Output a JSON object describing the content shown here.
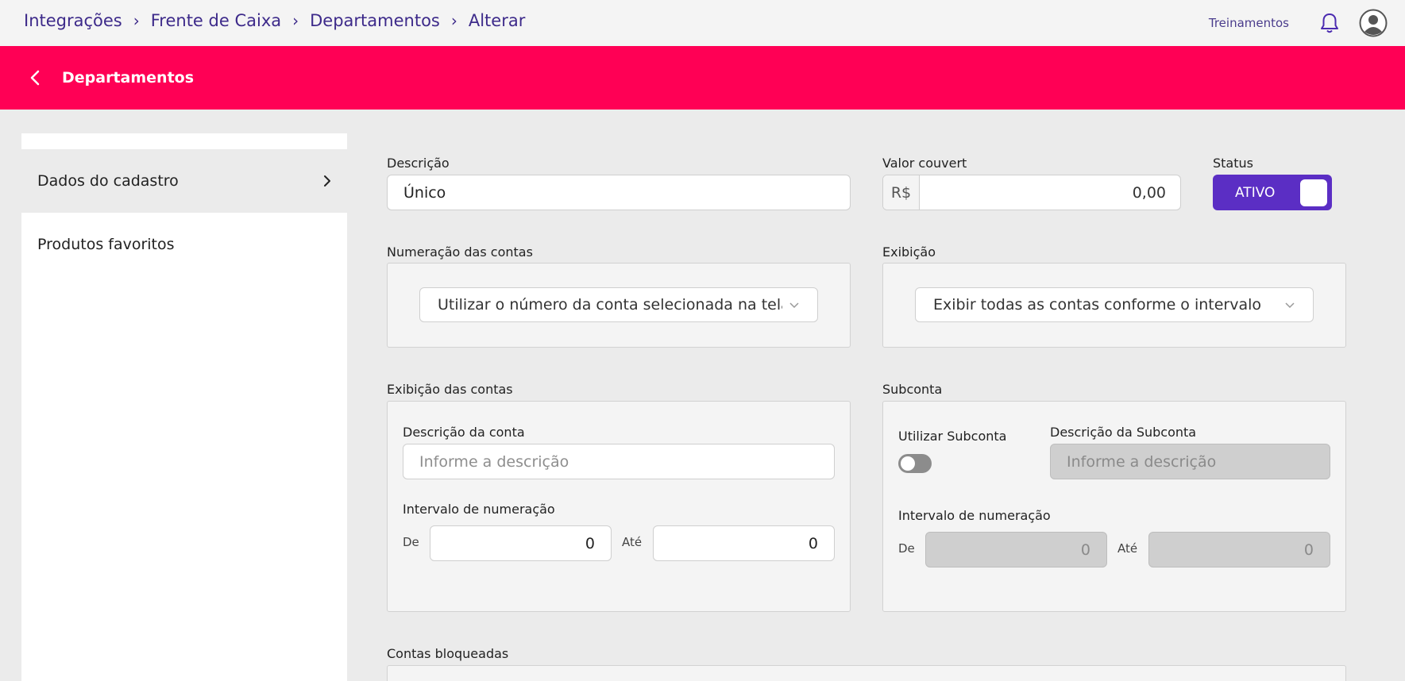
{
  "breadcrumb": [
    "Integrações",
    "Frente de Caixa",
    "Departamentos",
    "Alterar"
  ],
  "topbar": {
    "training_label": "Treinamentos",
    "icons": [
      "bell-icon",
      "user-avatar-icon"
    ]
  },
  "header": {
    "title": "Departamentos",
    "back_icon": "chevron-left-icon",
    "color": "#ff0055"
  },
  "sidebar": {
    "items": [
      {
        "label": "Dados do cadastro",
        "active": true
      },
      {
        "label": "Produtos favoritos",
        "active": false
      }
    ]
  },
  "form": {
    "descricao": {
      "label": "Descrição",
      "value": "Único"
    },
    "valor_couvert": {
      "label": "Valor couvert",
      "prefix": "R$",
      "value": "0,00"
    },
    "status": {
      "label": "Status",
      "value": "ATIVO",
      "color": "#5b2ec4"
    },
    "numeracao": {
      "label": "Numeração das contas",
      "selected": "Utilizar o número da conta selecionada na tela de vendas"
    },
    "exibicao": {
      "label": "Exibição",
      "selected": "Exibir todas as contas conforme o intervalo"
    },
    "exibicao_contas": {
      "label": "Exibição das contas",
      "descricao_label": "Descrição da conta",
      "descricao_placeholder": "Informe a descrição",
      "intervalo_label": "Intervalo de numeração",
      "de_label": "De",
      "de_value": "0",
      "ate_label": "Até",
      "ate_value": "0"
    },
    "subconta": {
      "label": "Subconta",
      "utilizar_label": "Utilizar Subconta",
      "utilizar_enabled": false,
      "descricao_label": "Descrição da Subconta",
      "descricao_placeholder": "Informe a descrição",
      "intervalo_label": "Intervalo de numeração",
      "de_label": "De",
      "de_value": "0",
      "ate_label": "Até",
      "ate_value": "0"
    },
    "contas_bloqueadas": {
      "label": "Contas bloqueadas"
    }
  }
}
